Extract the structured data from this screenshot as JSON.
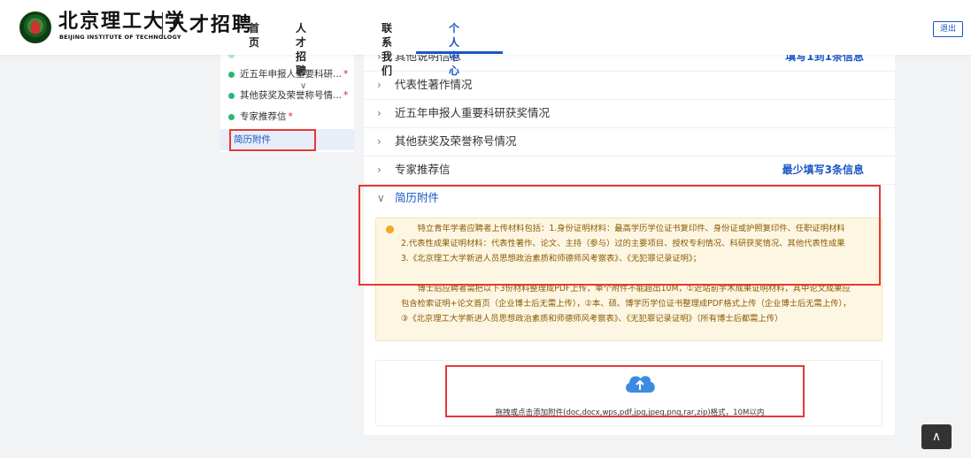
{
  "header": {
    "logo_cn": "北京理工大学",
    "logo_en": "BEIJING INSTITUTE OF TECHNOLOGY",
    "logo_sub": "人才招聘",
    "nav": [
      {
        "label": "首页"
      },
      {
        "label": "人才招聘"
      },
      {
        "label": "联系我们"
      },
      {
        "label": "个人中心"
      }
    ],
    "logout": "退出",
    "accent": "#1a56c4"
  },
  "sidebar": {
    "items": [
      {
        "label": "近五年申报人重要科研...",
        "required": "*"
      },
      {
        "label": "其他获奖及荣誉称号情...",
        "required": "*"
      },
      {
        "label": "专家推荐信",
        "required": "*"
      },
      {
        "label": "简历附件",
        "required": ""
      }
    ]
  },
  "main": {
    "sections": [
      {
        "title": "其他说明信息",
        "note": "填写1到1条信息"
      },
      {
        "title": "代表性著作情况",
        "note": ""
      },
      {
        "title": "近五年申报人重要科研获奖情况",
        "note": ""
      },
      {
        "title": "其他获奖及荣誉称号情况",
        "note": ""
      },
      {
        "title": "专家推荐信",
        "note": "最少填写3条信息"
      },
      {
        "title": "简历附件",
        "note": ""
      }
    ],
    "notice": {
      "para1": "特立青年学者应聘者上传材料包括：1.身份证明材料：最高学历学位证书复印件、身份证或护照复印件、任职证明材料 2.代表性成果证明材料：代表性著作、论文、主持（参与）过的主要项目、授权专利情况、科研获奖情况、其他代表性成果 3.《北京理工大学新进人员思想政治素质和师德师风考察表》、《无犯罪记录证明》；",
      "para2": "博士后应聘者需把以下3份材料整理成PDF上传，单个附件不能超出10M，①近站前学术成果证明材料，其中论文成果应包含检索证明+论文首页（企业博士后无需上传），②本、硕、博学历学位证书整理成PDF格式上传（企业博士后无需上传），③《北京理工大学新进人员思想政治素质和师德师风考察表》、《无犯罪记录证明》（所有博士后都需上传）"
    },
    "upload_hint": "拖拽或点击添加附件(doc,docx,wps,pdf,jpg,jpeg,png,rar,zip)格式，10M以内"
  },
  "colors": {
    "note_blue": "#1a56c4",
    "highlight_red": "#e53935",
    "notice_bg": "#fdf6e3",
    "notice_text": "#8a5a00",
    "dot_green": "#2bb673",
    "dot_orange": "#f5a623"
  },
  "icons": {
    "upload": "cloud-upload-icon",
    "back_to_top": "chevron-up-icon",
    "nav_dropdown": "chevron-down-icon",
    "section_toggle": "chevron-right-icon"
  }
}
